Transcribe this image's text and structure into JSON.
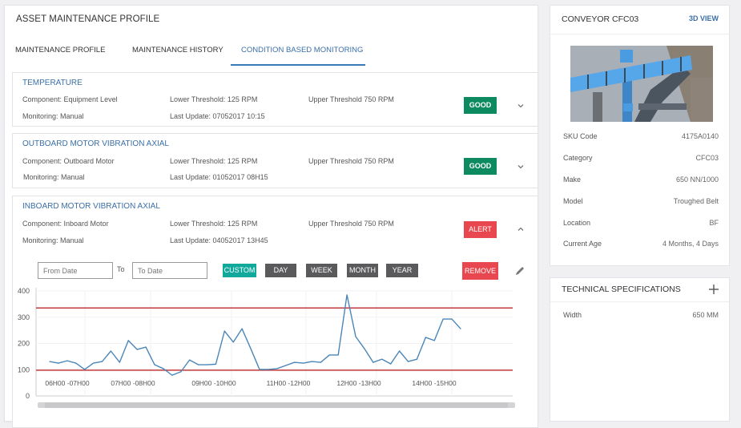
{
  "page": {
    "title": "ASSET MAINTENANCE PROFILE",
    "tabs": [
      {
        "label": "MAINTENANCE PROFILE",
        "active": false
      },
      {
        "label": "MAINTENANCE HISTORY",
        "active": false
      },
      {
        "label": "CONDITION BASED MONITORING",
        "active": true
      }
    ]
  },
  "monitors": [
    {
      "title": "TEMPERATURE",
      "component": "Component:  Equipment Level",
      "monitoring": "Monitoring:  Manual",
      "lower": "Lower Threshold:  125 RPM",
      "upper": "Upper Threshold 750 RPM",
      "last_update": "Last Update:  07052017 10:15",
      "status": "GOOD",
      "expanded": false
    },
    {
      "title": "OUTBOARD MOTOR VIBRATION AXIAL",
      "component": "Component:  Outboard Motor",
      "monitoring": "Monitoring:  Manual",
      "lower": "Lower Threshold:  125 RPM",
      "upper": "Upper Threshold 750 RPM",
      "last_update": "Last Update:  01052017   08H15",
      "status": "GOOD",
      "expanded": false
    },
    {
      "title": "INBOARD MOTOR VIBRATION AXIAL",
      "component": "Component:  Inboard Motor",
      "monitoring": "Monitoring:  Manual",
      "lower": "Lower Threshold:  125 RPM",
      "upper": "Upper Threshold 750 RPM",
      "last_update": "Last Update:  04052017    13H45",
      "status": "ALERT",
      "expanded": true
    }
  ],
  "filters": {
    "from_placeholder": "From Date",
    "to_label": "To",
    "to_placeholder": "To Date",
    "ranges": [
      "CUSTOM",
      "DAY",
      "WEEK",
      "MONTH",
      "YEAR"
    ],
    "active_range": "CUSTOM",
    "remove_label": "REMOVE"
  },
  "colors": {
    "accent": "#3a6fa8",
    "good": "#0d8a5f",
    "alert": "#e9474f",
    "custom": "#10a99b",
    "line": "#4a86b8",
    "threshold": "#c0393b"
  },
  "chart_data": {
    "type": "line",
    "title": "",
    "xlabel": "",
    "ylabel": "",
    "ylim": [
      0,
      400
    ],
    "yticks": [
      0,
      100,
      200,
      300,
      400
    ],
    "x_tick_labels": [
      "06H00 -07H00",
      "07H00 -08H00",
      "09H00 -10H00",
      "11H00 -12H00",
      "12H00 -13H00",
      "14H00 -15H00"
    ],
    "grid": true,
    "thresholds": {
      "upper": 335,
      "lower": 98
    },
    "series": [
      {
        "name": "Inboard Motor Vibration Axial",
        "values": [
          131,
          125,
          134,
          125,
          101,
          125,
          131,
          171,
          128,
          211,
          177,
          186,
          119,
          104,
          79,
          92,
          137,
          119,
          119,
          121,
          247,
          205,
          256,
          180,
          101,
          101,
          104,
          116,
          128,
          125,
          131,
          128,
          156,
          156,
          385,
          226,
          180,
          128,
          140,
          122,
          171,
          131,
          140,
          223,
          211,
          293,
          293,
          256
        ]
      }
    ]
  },
  "asset": {
    "title": "CONVEYOR CFC03",
    "view_label": "3D VIEW",
    "details": [
      {
        "label": "SKU Code",
        "value": "4175A0140"
      },
      {
        "label": "Category",
        "value": "CFC03"
      },
      {
        "label": "Make",
        "value": "650 NN/1000"
      },
      {
        "label": "Model",
        "value": "Troughed Belt"
      },
      {
        "label": "Location",
        "value": "BF"
      },
      {
        "label": "Current Age",
        "value": "4 Months, 4 Days"
      }
    ]
  },
  "specs": {
    "title": "TECHNICAL SPECIFICATIONS",
    "items": [
      {
        "label": "Width",
        "value": "650 MM"
      }
    ]
  }
}
